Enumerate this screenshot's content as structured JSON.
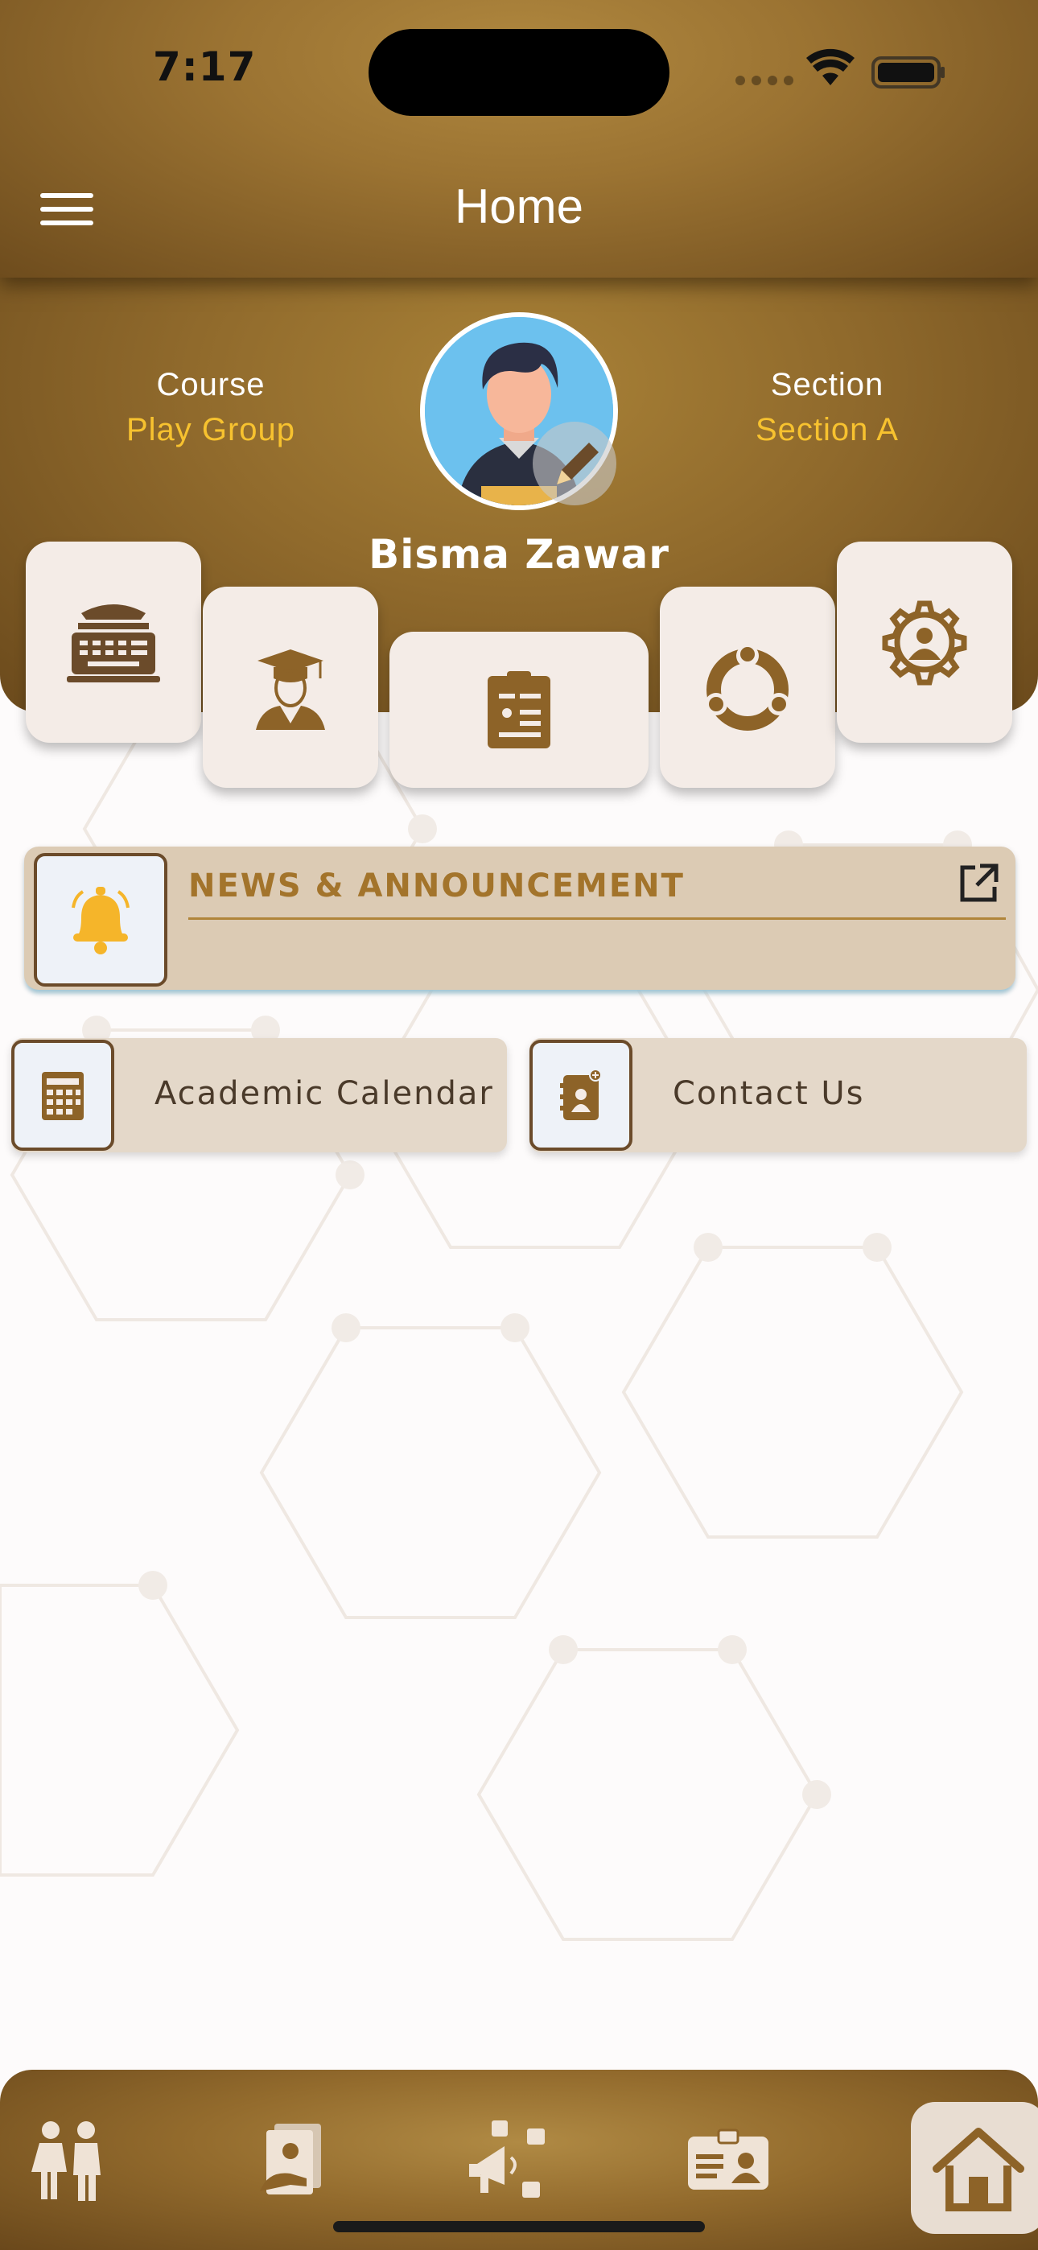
{
  "status_bar": {
    "time": "7:17"
  },
  "header": {
    "title": "Home",
    "menu_icon": "hamburger-menu-icon"
  },
  "profile": {
    "course_label": "Course",
    "course_value": "Play Group",
    "section_label": "Section",
    "section_value": "Section A",
    "name": "Bisma Zawar",
    "edit_icon": "pencil-icon"
  },
  "quick_tiles": [
    {
      "icon": "typewriter-icon"
    },
    {
      "icon": "graduate-icon"
    },
    {
      "icon": "report-card-icon"
    },
    {
      "icon": "network-users-icon"
    },
    {
      "icon": "settings-user-icon"
    }
  ],
  "news": {
    "title": "NEWS & ANNOUNCEMENT",
    "icon": "bell-icon",
    "open_icon": "open-external-icon"
  },
  "shortcuts": [
    {
      "label": "Academic Calendar",
      "icon": "calendar-icon"
    },
    {
      "label": "Contact Us",
      "icon": "contact-book-icon"
    }
  ],
  "bottom_nav": [
    {
      "icon": "family-icon"
    },
    {
      "icon": "fee-document-icon"
    },
    {
      "icon": "social-megaphone-icon"
    },
    {
      "icon": "id-card-icon"
    },
    {
      "icon": "home-icon",
      "active": true
    }
  ],
  "colors": {
    "brand": "#9b7332",
    "accent_yellow": "#f7c22f",
    "tile_bg": "#f4ece7",
    "card_bg": "#dccbb4"
  }
}
